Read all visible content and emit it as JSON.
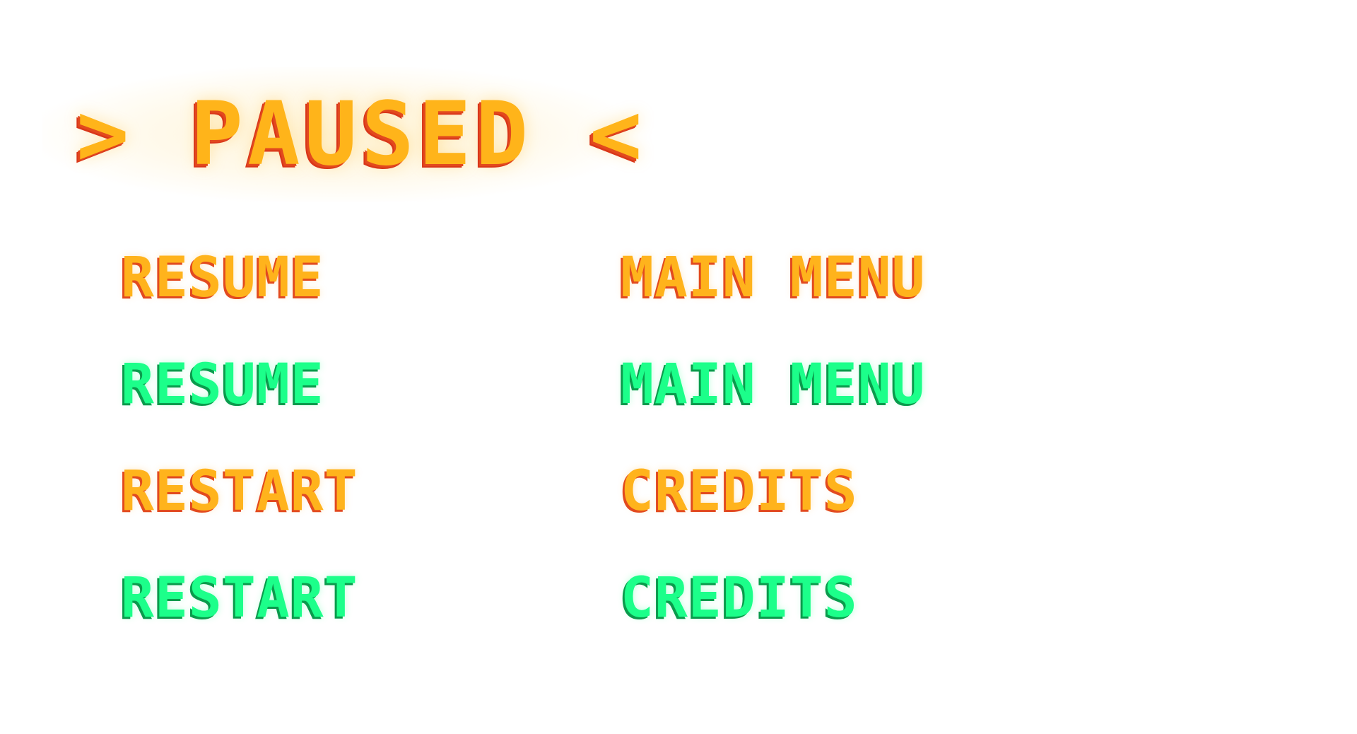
{
  "pause_menu": {
    "title": "> PAUSED <",
    "items": [
      {
        "label": "RESUME",
        "state": "normal",
        "color": "#ffb31c"
      },
      {
        "label": "MAIN MENU",
        "state": "normal",
        "color": "#ffb31c"
      },
      {
        "label": "RESUME",
        "state": "highlighted",
        "color": "#1cff8a"
      },
      {
        "label": "MAIN MENU",
        "state": "highlighted",
        "color": "#1cff8a"
      },
      {
        "label": "RESTART",
        "state": "normal",
        "color": "#ffb31c"
      },
      {
        "label": "CREDITS",
        "state": "normal",
        "color": "#ffb31c"
      },
      {
        "label": "RESTART",
        "state": "highlighted",
        "color": "#1cff8a"
      },
      {
        "label": "CREDITS",
        "state": "highlighted",
        "color": "#1cff8a"
      }
    ]
  },
  "colors": {
    "primary_text": "#ffb31c",
    "primary_shadow": "#e24a1f",
    "highlight_text": "#1cff8a",
    "highlight_shadow": "#0a9b4c",
    "background": "#ffffff"
  }
}
